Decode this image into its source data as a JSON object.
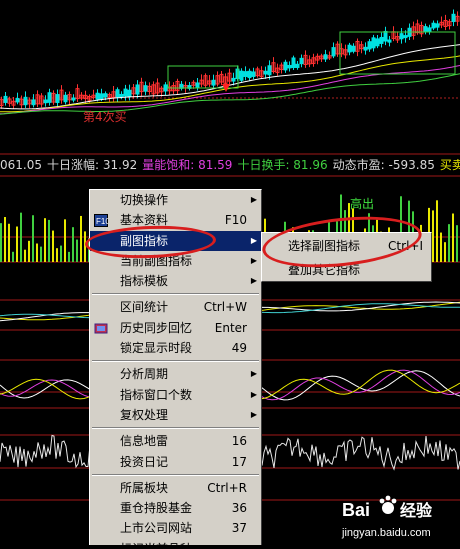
{
  "chart": {
    "annotation_low": "第4次买",
    "annotation_high": "高出"
  },
  "indicator_bar": {
    "items": [
      {
        "text": "061.05",
        "color": "#d8d8d8"
      },
      {
        "text": "十日涨幅: 31.92",
        "color": "#d8d8d8"
      },
      {
        "text": "量能饱和: 81.59",
        "color": "#e040e0"
      },
      {
        "text": "十日换手: 81.96",
        "color": "#40d040"
      },
      {
        "text": "动态市盈: -593.85",
        "color": "#d8d8d8"
      },
      {
        "text": "买卖盘比:",
        "color": "#e8e800"
      }
    ]
  },
  "context_menu": {
    "items": [
      {
        "label": "切换操作",
        "arrow": true
      },
      {
        "label": "基本资料",
        "shortcut": "F10",
        "icon": "f10-icon"
      },
      {
        "label": "副图指标",
        "arrow": true,
        "selected": true
      },
      {
        "label": "当前副图指标",
        "arrow": true
      },
      {
        "label": "指标模板",
        "arrow": true
      },
      {
        "separator": true
      },
      {
        "label": "区间统计",
        "shortcut": "Ctrl+W"
      },
      {
        "label": "历史同步回忆",
        "shortcut": "Enter",
        "icon": "history-icon"
      },
      {
        "label": "锁定显示时段",
        "shortcut": "49"
      },
      {
        "separator": true
      },
      {
        "label": "分析周期",
        "arrow": true
      },
      {
        "label": "指标窗口个数",
        "arrow": true
      },
      {
        "label": "复权处理",
        "arrow": true
      },
      {
        "separator": true
      },
      {
        "label": "信息地雷",
        "shortcut": "16"
      },
      {
        "label": "投资日记",
        "shortcut": "17"
      },
      {
        "separator": true
      },
      {
        "label": "所属板块",
        "shortcut": "Ctrl+R"
      },
      {
        "label": "重仓持股基金",
        "shortcut": "36"
      },
      {
        "label": "上市公司网站",
        "shortcut": "37"
      },
      {
        "label": "标记当前品种",
        "arrow": true
      }
    ]
  },
  "submenu": {
    "items": [
      {
        "label": "选择副图指标",
        "shortcut": "Ctrl+I"
      },
      {
        "label": "叠加其它指标"
      }
    ]
  },
  "watermark": {
    "brand": "Bai",
    "brand2": "经验",
    "url": "jingyan.baidu.com"
  },
  "colors": {
    "menu_bg": "#d4d0c8",
    "menu_selected": "#0a246a",
    "highlight_ring": "#d81e1e",
    "up_candle": "#ff3030",
    "down_candle": "#00e0e0"
  }
}
